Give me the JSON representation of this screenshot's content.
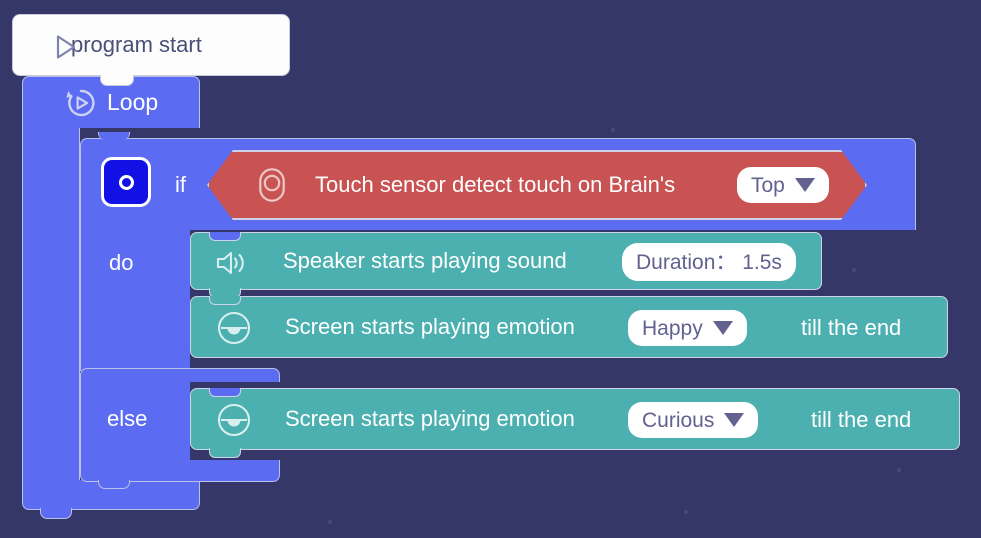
{
  "canvas": {
    "background_color": "#353769",
    "title": "Block program canvas"
  },
  "palette": {
    "event_block": "#fdfdfd",
    "control_block": "#5c6cf2",
    "condition_block": "#c95252",
    "action_block": "#4cb0b0",
    "toggle_active": "#1111e6",
    "chip_text": "#62618f"
  },
  "program": {
    "start_block": {
      "label": "program start",
      "icon": "play-outline-icon"
    },
    "loop_block": {
      "label": "Loop",
      "icon": "loop-refresh-icon"
    },
    "if_block": {
      "toggle_icon": "radio-on-icon",
      "if_label": "if",
      "do_label": "do",
      "else_label": "else",
      "condition": {
        "icon": "touch-sensor-icon",
        "text": "Touch sensor detect touch on Brain's",
        "dropdown": {
          "value": "Top",
          "caret": "caret-down-icon"
        }
      },
      "do_statements": [
        {
          "icon": "speaker-icon",
          "text": "Speaker starts playing sound",
          "field": {
            "label": "Duration：",
            "value": "1.5s",
            "display": "Duration： 1.5s"
          }
        },
        {
          "icon": "emotion-face-icon",
          "text": "Screen starts playing emotion",
          "dropdown": {
            "value": "Happy",
            "caret": "caret-down-icon"
          },
          "trailing_text": "till the end"
        }
      ],
      "else_statements": [
        {
          "icon": "emotion-face-icon",
          "text": "Screen starts playing emotion",
          "dropdown": {
            "value": "Curious",
            "caret": "caret-down-icon"
          },
          "trailing_text": "till the end"
        }
      ]
    }
  }
}
